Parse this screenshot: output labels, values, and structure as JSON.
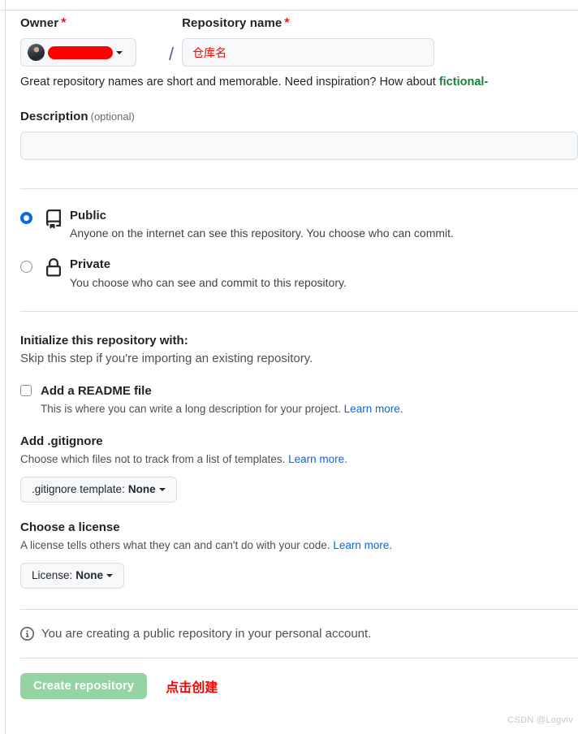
{
  "form": {
    "owner": {
      "label": "Owner",
      "required_marker": "*",
      "avatar_name": "user-avatar",
      "username_redacted": true,
      "redaction_color": "#fe0000"
    },
    "separator": "/",
    "repository_name": {
      "label": "Repository name",
      "required_marker": "*",
      "value": "",
      "annotation": "仓库名"
    },
    "hint": {
      "text": "Great repository names are short and memorable. Need inspiration? How about ",
      "suggestion": "fictional-",
      "suggestion_color": "#1a7f37"
    },
    "description": {
      "label": "Description",
      "optional_label": "(optional)",
      "value": ""
    },
    "visibility": {
      "selected": "public",
      "options": [
        {
          "id": "public",
          "title": "Public",
          "description": "Anyone on the internet can see this repository. You choose who can commit.",
          "icon": "repo-icon",
          "checked": true
        },
        {
          "id": "private",
          "title": "Private",
          "description": "You choose who can see and commit to this repository.",
          "icon": "lock-icon",
          "checked": false
        }
      ]
    },
    "initialize": {
      "title": "Initialize this repository with:",
      "subtitle": "Skip this step if you're importing an existing repository.",
      "readme": {
        "label": "Add a README file",
        "checked": false,
        "description": "This is where you can write a long description for your project. ",
        "link_text": "Learn more",
        "link_suffix": "."
      }
    },
    "gitignore": {
      "title": "Add .gitignore",
      "description": "Choose which files not to track from a list of templates. ",
      "link_text": "Learn more",
      "link_suffix": ".",
      "button_prefix": ".gitignore template:",
      "button_value": "None"
    },
    "license": {
      "title": "Choose a license",
      "description": "A license tells others what they can and can't do with your code. ",
      "link_text": "Learn more",
      "link_suffix": ".",
      "button_prefix": "License:",
      "button_value": "None"
    },
    "notice": {
      "icon": "info-icon",
      "text": "You are creating a public repository in your personal account."
    },
    "submit": {
      "label": "Create repository",
      "enabled": false,
      "color": "#94d3a2",
      "annotation": "点击创建",
      "annotation_color": "#fe0000"
    }
  },
  "watermark": {
    "text": "CSDN @Logviv"
  }
}
